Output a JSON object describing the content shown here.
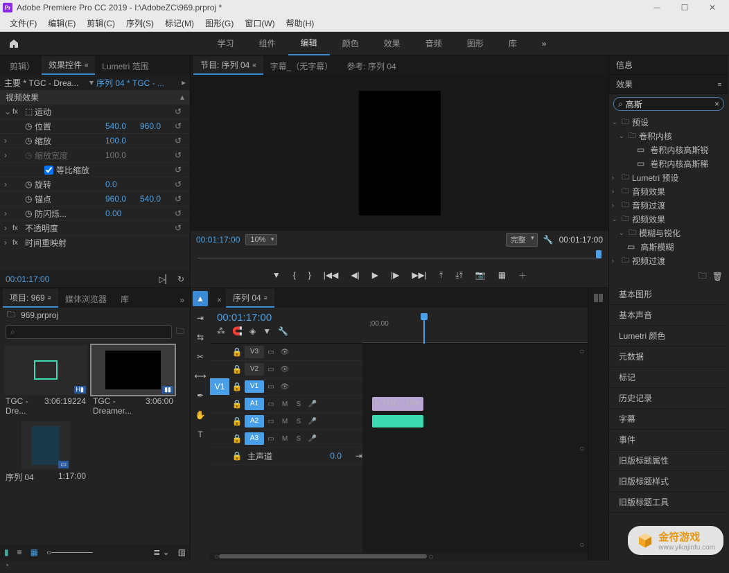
{
  "title": "Adobe Premiere Pro CC 2019 - I:\\AdobeZC\\969.prproj *",
  "menu": [
    "文件(F)",
    "编辑(E)",
    "剪辑(C)",
    "序列(S)",
    "标记(M)",
    "图形(G)",
    "窗口(W)",
    "帮助(H)"
  ],
  "workspaces": [
    "学习",
    "组件",
    "编辑",
    "颜色",
    "效果",
    "音频",
    "图形",
    "库"
  ],
  "ws_active": "编辑",
  "left_tabs": {
    "edit": "剪辑）",
    "fx": "效果控件",
    "lum": "Lumetri 范围"
  },
  "bc1": "主要 * TGC - Drea...",
  "bc2": "序列 04 * TGC - ...",
  "fx_header": "视频效果",
  "motion": {
    "name": "运动",
    "pos": "位置",
    "pos_x": "540.0",
    "pos_y": "960.0",
    "scale": "缩放",
    "scale_v": "100.0",
    "scalew": "缩放宽度",
    "scalew_v": "100.0",
    "uniform": "等比缩放",
    "rot": "旋转",
    "rot_v": "0.0",
    "anchor": "锚点",
    "anch_x": "960.0",
    "anch_y": "540.0",
    "flick": "防闪烁...",
    "flick_v": "0.00"
  },
  "opacity": "不透明度",
  "remap": "时间重映射",
  "tc": "00:01:17:00",
  "prog_tabs": {
    "prog": "节目: 序列 04",
    "cap": "字幕_（无字幕）",
    "ref": "参考: 序列 04"
  },
  "zoom": "10%",
  "fit": "完整",
  "tc_right": "00:01:17:00",
  "proj_tabs": {
    "proj": "项目: 969",
    "media": "媒体浏览器",
    "lib": "库"
  },
  "proj_file": "969.prproj",
  "bins": [
    {
      "name": "TGC - Dre...",
      "dur": "3:06:19224",
      "type": "audio"
    },
    {
      "name": "TGC - Dreamer...",
      "dur": "3:06:00",
      "type": "video",
      "sel": true
    },
    {
      "name": "序列 04",
      "dur": "1:17:00",
      "type": "seq"
    }
  ],
  "tl_tab": "序列 04",
  "tl_tc": "00:01:17:00",
  "ruler_tick": ";00:00",
  "tracks_v": [
    "V3",
    "V2",
    "V1"
  ],
  "tracks_a": [
    "A1",
    "A2",
    "A3"
  ],
  "master": "主声道",
  "master_v": "0.0",
  "clip_v": "TGC - Dre",
  "right_panels": [
    "信息",
    "效果"
  ],
  "eff_search": "高斯",
  "eff_tree": {
    "presets": "预设",
    "conv": "卷积内核",
    "conv1": "卷积内核高斯锐",
    "conv2": "卷积内核高斯稀",
    "lum": "Lumetri 预设",
    "audiofx": "音频效果",
    "audiotr": "音频过渡",
    "videofx": "视频效果",
    "blur": "模糊与锐化",
    "gauss": "高斯模糊",
    "videotr": "视频过渡"
  },
  "side_panels": [
    "基本图形",
    "基本声音",
    "Lumetri 颜色",
    "元数据",
    "标记",
    "历史记录",
    "字幕",
    "事件",
    "旧版标题属性",
    "旧版标题样式",
    "旧版标题工具"
  ],
  "watermark": {
    "brand": "金符游戏",
    "url": "www.yikajinfu.com"
  }
}
